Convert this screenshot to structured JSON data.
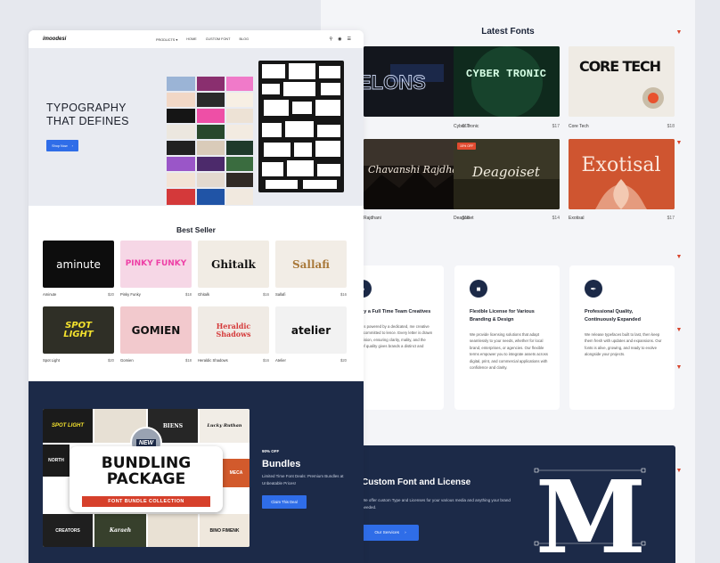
{
  "latest": {
    "title": "Latest Fonts",
    "cards": [
      {
        "name": "",
        "price": "$18",
        "preview": "ELONS"
      },
      {
        "name": "Cyber Tronic",
        "price": "$17",
        "preview": "CYBER TRONIC"
      },
      {
        "name": "Core Tech",
        "price": "$18",
        "preview": "CORE TECH"
      },
      {
        "name": "Rajdhani",
        "price": "$18",
        "preview": "Chavanshi Rajdhani"
      },
      {
        "name": "Deagoiset",
        "price": "$14",
        "preview": "Deagoiset",
        "badge": "15% OFF"
      },
      {
        "name": "Exotisal",
        "price": "$17",
        "preview": "Exotisal"
      }
    ]
  },
  "features": [
    {
      "title": "de by a Full Time Team Creatives",
      "text": "work is powered by a dedicated, me creative team committed to lence. Every letter is drawn with vision, ensuring clarity, mality, and the kind of quality gives brands a distinct and voice."
    },
    {
      "title": "Flexible License for Various Branding & Design",
      "text": "We provide licensing solutions that adapt seamlessly to your needs, whether for local brand, enterprises, or agencies. Our flexible terms empower you to integrate assets across digital, print, and commercial applications with confidence and clarity."
    },
    {
      "title": "Professional Quality, Continuously Expanded",
      "text": "We release typefaces built to last, then keep them fresh with updates and expansions. Our fonts is alive, growing, and ready to evolve alongside your projects."
    }
  ],
  "custom": {
    "title": "Custom Font and License",
    "text": "We offer custom Type and Licenses for your various media and anything your brand needed.",
    "button": "Our Services",
    "mark": "M"
  },
  "nav": {
    "logo": "imoodesi",
    "links": [
      "PRODUCTS",
      "HOME",
      "CUSTOM FONT",
      "BLOG"
    ]
  },
  "hero": {
    "heading_1": "TYPOGRAPHY",
    "heading_2": "THAT DEFINES",
    "button": "Shop Now"
  },
  "best": {
    "title": "Best Seller",
    "cards": [
      {
        "name": "Aminute",
        "price": "$20",
        "preview": "aminute"
      },
      {
        "name": "Pinky Funky",
        "price": "$18",
        "preview": "PINKY FUNKY"
      },
      {
        "name": "Ghitalk",
        "price": "$16",
        "preview": "Ghitalk"
      },
      {
        "name": "Sallafi",
        "price": "$16",
        "preview": "Sallafi"
      },
      {
        "name": "Spot Light",
        "price": "$20",
        "preview": "SPOT LIGHT"
      },
      {
        "name": "Gomien",
        "price": "$18",
        "preview": "GOMIEN"
      },
      {
        "name": "Heraldic Shadows",
        "price": "$16",
        "preview": "Heraldic Shadows"
      },
      {
        "name": "Atelier",
        "price": "$20",
        "preview": "atelier"
      }
    ]
  },
  "bundle": {
    "badge": "NEW",
    "package_1": "BUNDLING",
    "package_2": "PACKAGE",
    "collection": "FONT BUNDLE COLLECTION",
    "off": "90% OFF",
    "title": "Bundles",
    "desc": "Limited Time Font Deals: Premium Bundles at Unbeatable Prices!",
    "cta": "Claim This Deal",
    "tiles": [
      "SPOT LIGHT",
      "BIENS",
      "Lucky Ruthan",
      "NORTH",
      "MECA",
      "CREATORS",
      "Karaeh",
      "BINO FIMENK"
    ]
  },
  "colors": {
    "navy": "#1c2a48",
    "blue": "#2f6de8",
    "pdf": "#d8452c"
  }
}
